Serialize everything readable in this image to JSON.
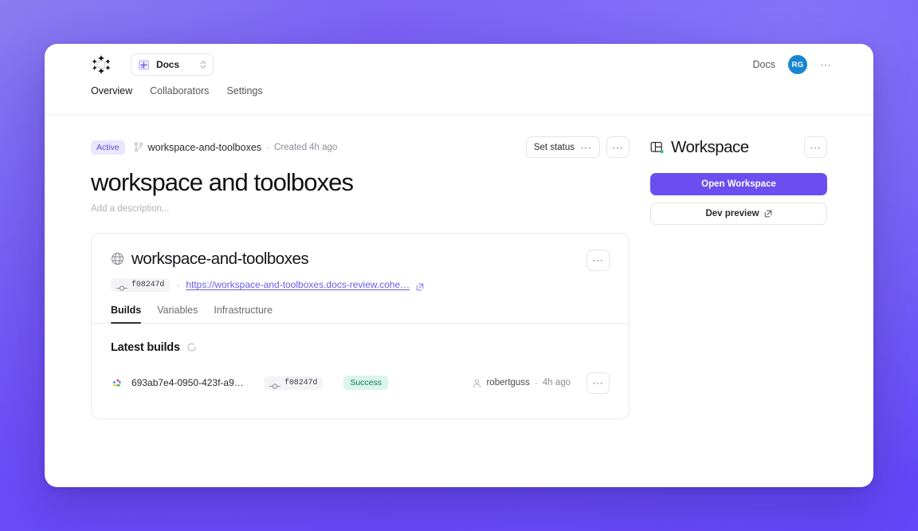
{
  "topbar": {
    "logo_name": "coherence-sparkle-logo",
    "workspace_selector": {
      "label": "Docs",
      "icon": "project-icon"
    },
    "docs_link": "Docs",
    "avatar_initials": "RG",
    "overflow_menu": "⋯"
  },
  "nav": {
    "tabs": [
      {
        "label": "Overview",
        "active": true
      },
      {
        "label": "Collaborators",
        "active": false
      },
      {
        "label": "Settings",
        "active": false
      }
    ]
  },
  "meta": {
    "status_badge": "Active",
    "branch_name": "workspace-and-toolboxes",
    "separator": "·",
    "created": "Created 4h ago",
    "set_status_label": "Set status",
    "set_status_dots": "⋯",
    "overflow_dots": "⋯"
  },
  "page": {
    "title": "workspace and toolboxes",
    "description_placeholder": "Add a description..."
  },
  "card": {
    "title": "workspace-and-toolboxes",
    "overflow_dots": "⋯",
    "commit_hash": "f08247d",
    "url": "https://workspace-and-toolboxes.docs-review.cohe…",
    "tabs": [
      {
        "label": "Builds",
        "active": true
      },
      {
        "label": "Variables",
        "active": false
      },
      {
        "label": "Infrastructure",
        "active": false
      }
    ],
    "builds_heading": "Latest builds",
    "builds": [
      {
        "provider_icon": "google-cloud-icon",
        "id": "693ab7e4-0950-423f-a9…",
        "commit_hash": "f08247d",
        "status": "Success",
        "author": "robertguss",
        "separator": "·",
        "time": "4h ago",
        "overflow_dots": "⋯"
      }
    ]
  },
  "sidebar": {
    "title": "Workspace",
    "overflow_dots": "⋯",
    "open_workspace_label": "Open Workspace",
    "dev_preview_label": "Dev preview"
  },
  "colors": {
    "accent": "#6a4ef0",
    "badge_active_bg": "#e9e6fd",
    "badge_active_text": "#5b49d6",
    "badge_success_bg": "#d9f5ec",
    "badge_success_text": "#16785c",
    "avatar_bg": "#1a86d0",
    "link": "#6b5bea"
  }
}
